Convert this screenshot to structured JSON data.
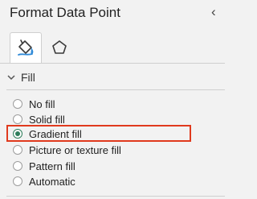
{
  "panel": {
    "title": "Format Data Point",
    "close_glyph": "‹"
  },
  "tabs": [
    {
      "name": "fill-and-line",
      "icon": "paint-bucket-icon",
      "active": true
    },
    {
      "name": "effects",
      "icon": "pentagon-icon",
      "active": false
    }
  ],
  "section": {
    "label": "Fill",
    "expanded": true
  },
  "fill_options": [
    {
      "label": "No fill",
      "selected": false
    },
    {
      "label": "Solid fill",
      "selected": false
    },
    {
      "label": "Gradient fill",
      "selected": true
    },
    {
      "label": "Picture or texture fill",
      "selected": false
    },
    {
      "label": "Pattern fill",
      "selected": false
    },
    {
      "label": "Automatic",
      "selected": false
    }
  ],
  "colors": {
    "accent_radio": "#2e7d5b",
    "highlight_border": "#e03a1e"
  }
}
